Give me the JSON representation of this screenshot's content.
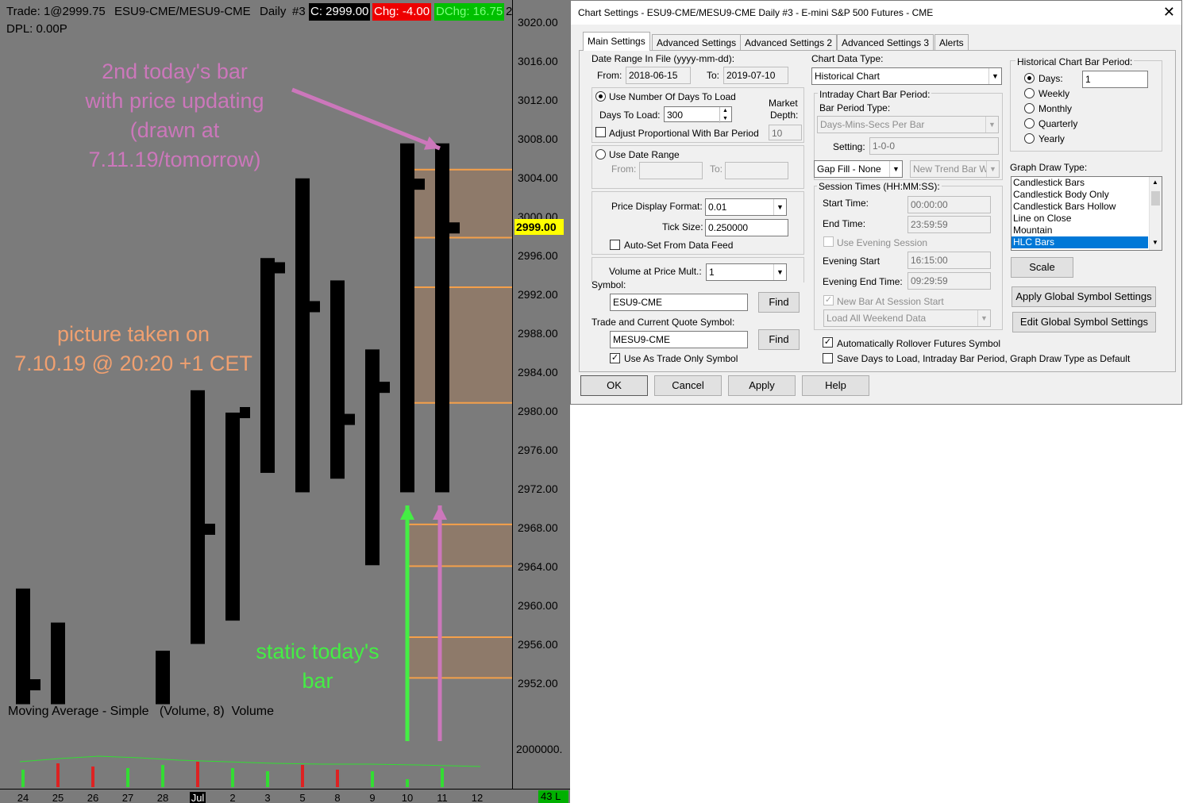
{
  "chart": {
    "header": {
      "trade": "Trade: 1@2999.75",
      "symbol": "ESU9-CME/MESU9-CME",
      "period": "Daily",
      "instance": "#3",
      "close": "C: 2999.00",
      "change": "Chg: -4.00",
      "dchg": "DChg: 16.75",
      "trailing": "2",
      "dpl": "DPL: 0.00P"
    },
    "price_axis": [
      "3020.00",
      "3016.00",
      "3012.00",
      "3008.00",
      "3004.00",
      "3000.00",
      "2996.00",
      "2992.00",
      "2988.00",
      "2984.00",
      "2980.00",
      "2976.00",
      "2972.00",
      "2968.00",
      "2964.00",
      "2960.00",
      "2956.00",
      "2952.00"
    ],
    "current_price": "2999.00",
    "volume_axis_label": "2000000.",
    "volume_value": "43 L",
    "study_label": "Moving Average - Simple   (Volume, 8)  Volume",
    "annotations": {
      "top": [
        "2nd today's bar",
        "with price updating",
        "(drawn at",
        "7.11.19/tomorrow)"
      ],
      "middle": [
        "picture taken on",
        "7.10.19 @ 20:20 +1 CET"
      ],
      "bottom": [
        "static today's",
        "bar"
      ]
    },
    "x_labels": [
      "24",
      "25",
      "26",
      "27",
      "28",
      "Jul",
      "2",
      "3",
      "5",
      "8",
      "9",
      "10",
      "11",
      "12"
    ],
    "colors": {
      "background": "#7b7b7b",
      "bar": "#000000",
      "level_line": "#f5a04a",
      "zone_fill": "#8e7a6a",
      "annot_pink": "#cc77bb",
      "annot_orange": "#f0a070",
      "annot_green": "#44ee44",
      "vol_up": "#33dd33",
      "vol_down": "#dd2222"
    }
  },
  "chart_data": {
    "type": "ohlc",
    "title": "ESU9-CME/MESU9-CME Daily",
    "categories": [
      "24",
      "25",
      "26",
      "27",
      "28",
      "Jul",
      "2",
      "3",
      "5",
      "8",
      "9",
      "10",
      "11",
      "12"
    ],
    "ylim": [
      2950,
      3021
    ],
    "bars": [
      {
        "x": "24",
        "high": 2961.9,
        "low": 2950.0,
        "close": 2952.0
      },
      {
        "x": "25",
        "high": 2958.4,
        "low": 2950.0,
        "close": null
      },
      {
        "x": "28",
        "high": 2955.5,
        "low": 2950.0,
        "close": null
      },
      {
        "x": "Jul",
        "high": 2982.3,
        "low": 2956.2,
        "close": 2968.0
      },
      {
        "x": "2",
        "high": 2980.0,
        "low": 2958.6,
        "close": 2980.0
      },
      {
        "x": "3",
        "high": 2995.9,
        "low": 2973.8,
        "close": 2994.9
      },
      {
        "x": "5",
        "high": 3004.1,
        "low": 2971.8,
        "close": 2990.9
      },
      {
        "x": "8",
        "high": 2993.6,
        "low": 2973.2,
        "close": 2979.3
      },
      {
        "x": "9",
        "high": 2986.5,
        "low": 2964.3,
        "close": 2982.6
      },
      {
        "x": "10",
        "high": 3007.7,
        "low": 2971.8,
        "close": 3003.5
      },
      {
        "x": "11",
        "high": 3007.7,
        "low": 2971.8,
        "close": 2999.0
      }
    ],
    "levels": [
      3005.0,
      2998.0,
      2992.9,
      2981.0,
      2968.5,
      2964.2,
      2956.9,
      2952.7
    ],
    "zones": [
      [
        2998.0,
        3005.0
      ],
      [
        2981.0,
        2992.9
      ],
      [
        2964.2,
        2968.5
      ],
      [
        2952.7,
        2956.9
      ]
    ],
    "volume": [
      {
        "x": "24",
        "dir": "up"
      },
      {
        "x": "25",
        "dir": "down"
      },
      {
        "x": "26",
        "dir": "down"
      },
      {
        "x": "27",
        "dir": "up"
      },
      {
        "x": "28",
        "dir": "up"
      },
      {
        "x": "Jul",
        "dir": "down"
      },
      {
        "x": "2",
        "dir": "up"
      },
      {
        "x": "3",
        "dir": "up"
      },
      {
        "x": "5",
        "dir": "down"
      },
      {
        "x": "8",
        "dir": "down"
      },
      {
        "x": "9",
        "dir": "up"
      },
      {
        "x": "10",
        "dir": "up"
      },
      {
        "x": "11",
        "dir": "up"
      }
    ]
  },
  "dialog": {
    "title": "Chart Settings - ESU9-CME/MESU9-CME  Daily  #3 - E-mini S&P 500 Futures - CME",
    "close_glyph": "✕",
    "tabs": [
      "Main Settings",
      "Advanced Settings",
      "Advanced Settings 2",
      "Advanced Settings 3",
      "Alerts"
    ],
    "date_range_label": "Date Range In File (yyyy-mm-dd):",
    "from_label": "From:",
    "from_value": "2018-06-15",
    "to_label": "To:",
    "to_value": "2019-07-10",
    "use_days_label": "Use Number Of Days To Load",
    "days_to_load_label": "Days To Load:",
    "days_to_load_value": "300",
    "market_depth_label1": "Market",
    "market_depth_label2": "Depth:",
    "market_depth_value": "10",
    "adjust_label": "Adjust Proportional With Bar Period",
    "use_date_range_label": "Use Date Range",
    "range_from_label": "From:",
    "range_to_label": "To:",
    "price_format_label": "Price Display Format:",
    "price_format_value": "0.01",
    "tick_size_label": "Tick Size:",
    "tick_size_value": "0.250000",
    "auto_set_label": "Auto-Set From Data Feed",
    "vap_label": "Volume at Price Mult.:",
    "vap_value": "1",
    "symbol_label": "Symbol:",
    "symbol_value": "ESU9-CME",
    "find_label": "Find",
    "trade_symbol_label": "Trade and Current Quote Symbol:",
    "trade_symbol_value": "MESU9-CME",
    "trade_only_label": "Use As Trade Only Symbol",
    "chart_data_type_label": "Chart Data Type:",
    "chart_data_type_value": "Historical Chart",
    "intraday_label": "Intraday Chart Bar Period:",
    "bar_period_type_label": "Bar Period Type:",
    "bar_period_type_value": "Days-Mins-Secs Per Bar",
    "setting_label": "Setting:",
    "setting_value": "1-0-0",
    "gap_fill_value": "Gap Fill - None",
    "new_trend_value": "New Trend Bar W",
    "session_label": "Session Times (HH:MM:SS):",
    "start_time_label": "Start Time:",
    "start_time_value": "00:00:00",
    "end_time_label": "End Time:",
    "end_time_value": "23:59:59",
    "use_evening_label": "Use Evening Session",
    "evening_start_label": "Evening Start",
    "evening_start_value": "16:15:00",
    "evening_end_label": "Evening End Time:",
    "evening_end_value": "09:29:59",
    "new_bar_label": "New Bar At Session Start",
    "weekend_value": "Load All Weekend Data",
    "auto_rollover_label": "Automatically Rollover Futures Symbol",
    "save_default_label": "Save Days to Load, Intraday Bar Period, Graph Draw Type as Default",
    "hist_period_label": "Historical Chart Bar Period:",
    "periods": [
      "Days:",
      "Weekly",
      "Monthly",
      "Quarterly",
      "Yearly"
    ],
    "days_value": "1",
    "graph_draw_label": "Graph Draw Type:",
    "draw_types": [
      "Candlestick Bars",
      "Candlestick Body Only",
      "Candlestick Bars Hollow",
      "Line on Close",
      "Mountain",
      "HLC Bars"
    ],
    "selected_draw_type": "HLC Bars",
    "scale_label": "Scale",
    "apply_global_label": "Apply Global Symbol Settings",
    "edit_global_label": "Edit Global Symbol Settings",
    "ok_label": "OK",
    "cancel_label": "Cancel",
    "apply_label": "Apply",
    "help_label": "Help"
  }
}
